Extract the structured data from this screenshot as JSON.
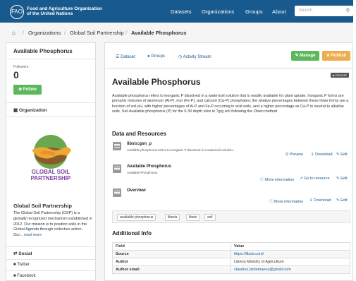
{
  "header": {
    "logo_glyph": "FAO",
    "org_name_line1": "Food and Agriculture Organization",
    "org_name_line2": "of the United Nations",
    "nav": [
      "Datasets",
      "Organizations",
      "Groups",
      "About"
    ],
    "search_placeholder": "Search",
    "search_icon": "search-icon",
    "brand_color": "#195a8e"
  },
  "breadcrumb": {
    "home_icon": "home-icon",
    "items": [
      "Organizations",
      "Global Soil Partnership",
      "Available Phosphorus"
    ]
  },
  "sidebar": {
    "title": "Available Phosphorus",
    "followers_label": "Followers",
    "followers_count": "0",
    "follow_label": "Follow",
    "organization_label": "Organization",
    "logo_text_line1": "GLOBAL SOIL",
    "logo_text_line2": "PARTNERSHIP",
    "org_title": "Global Soil Partnership",
    "org_description": "The Global Soil Partnership (GSP) is a globally recognized mechanism established in 2012. Our mission is to position soils in the Global Agenda through collective action. Our...",
    "read_more": "read more",
    "social_label": "Social",
    "social_links": [
      "Twitter",
      "Facebook"
    ]
  },
  "main": {
    "tabs": [
      "Dataset",
      "Groups",
      "Activity Stream"
    ],
    "manage_label": "Manage",
    "publish_label": "Publish",
    "manage_color": "#5cb85c",
    "publish_color": "#f0ad4e",
    "private_badge": "PRIVATE",
    "title": "Available Phosphorus",
    "description": "Available phosphorus refers to inorganic P dissolved in a water/soil solution that is readily available for plant uptake. Inorganic P forms are primarily mixtures of aluminum (Al-P), iron (Fe-P), and calcium (Ca-P) phosphates; the relative percentages between these three forms are a function of soil pH, with higher percentages of Al-P and Fe-P occurring in acid soils, and a higher percentage as Ca-P in neutral to alkaline soils. Soil Available phosphorus (P) for the 0-30 depth slice in ?g/g soil following the Olsen method",
    "resources_heading": "Data and Resources",
    "resources": [
      {
        "title": "libsis:gsn_p",
        "desc": "Available phosphorus refers to inorganic P dissolved in a water/soil solution...",
        "actions": [
          "Preview",
          "Download",
          "Edit"
        ]
      },
      {
        "title": "Available Phosphorus",
        "desc": "Available Phosphorus",
        "actions": [
          "More information",
          "Go to resource",
          "Edit"
        ]
      },
      {
        "title": "Overview",
        "desc": "",
        "actions": [
          "More information",
          "Download",
          "Edit"
        ]
      }
    ],
    "tags": [
      "available phosphorus",
      "liberia",
      "libsis",
      "soil"
    ],
    "additional_info_heading": "Additional Info",
    "table": {
      "headers": [
        "Field",
        "Value"
      ],
      "rows": [
        [
          "Source",
          "https://libsis.com/"
        ],
        [
          "Author",
          "Liberia Ministry of Agriculture"
        ],
        [
          "Author email",
          "claudius.ptolemaeus@gmail.com"
        ]
      ]
    }
  }
}
